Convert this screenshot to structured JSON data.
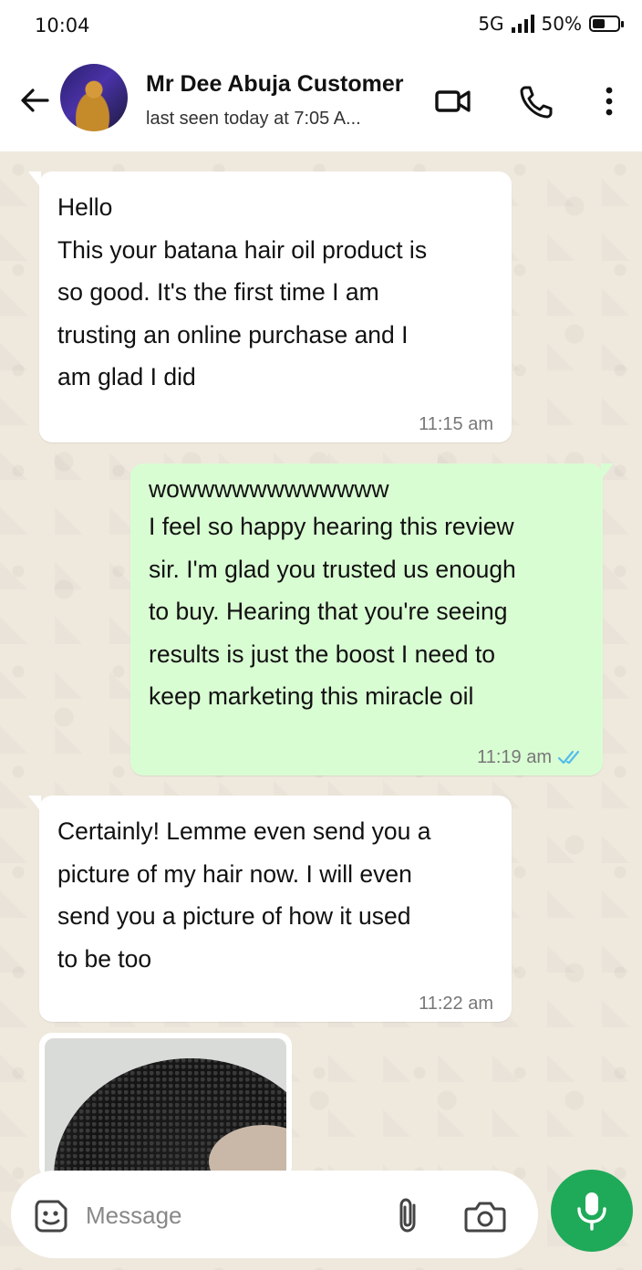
{
  "status": {
    "time": "10:04",
    "network": "5G",
    "battery": "50%",
    "battery_level": 0.5
  },
  "header": {
    "contact_name": "Mr Dee Abuja Customer",
    "last_seen": "last seen today at 7:05 A..."
  },
  "messages": [
    {
      "direction": "in",
      "lines": [
        "Hello",
        "This your batana hair oil product is",
        "so good. It's the first time I am",
        "trusting an online purchase and I",
        "am glad I did"
      ],
      "time": "11:15 am"
    },
    {
      "direction": "out",
      "lines": [
        "wowwwwwwwwwwww",
        "I feel so happy hearing this review",
        "sir. I'm glad you trusted us enough",
        "to buy. Hearing that you're seeing",
        "results is just the boost I need to",
        "keep marketing this miracle oil"
      ],
      "time": "11:19 am",
      "status": "read"
    },
    {
      "direction": "in",
      "lines": [
        "Certainly! Lemme even send you a",
        "picture of my hair now. I will even",
        "send you a picture of how it used",
        "to be too"
      ],
      "time": "11:22 am"
    }
  ],
  "composer": {
    "placeholder": "Message"
  },
  "colors": {
    "outgoing_bubble": "#d9fdd3",
    "incoming_bubble": "#ffffff",
    "mic_button": "#1faa59",
    "read_ticks": "#53bdeb"
  }
}
